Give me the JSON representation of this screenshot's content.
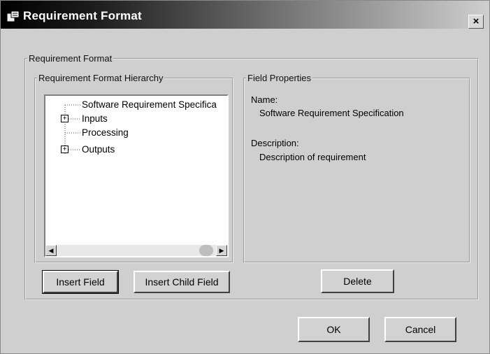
{
  "window": {
    "title": "Requirement Format",
    "close_label": "×"
  },
  "outer_group": {
    "label": "Requirement Format"
  },
  "hierarchy_group": {
    "label": "Requirement Format Hierarchy",
    "tree": [
      {
        "label": "Software Requirement Specifica",
        "expandable": false
      },
      {
        "label": "Inputs",
        "expandable": true,
        "expander": "+"
      },
      {
        "label": "Processing",
        "expandable": false
      },
      {
        "label": "Outputs",
        "expandable": true,
        "expander": "+"
      }
    ],
    "scroll_left": "◀",
    "scroll_right": "▶"
  },
  "properties_group": {
    "label": "Field Properties",
    "name_label": "Name:",
    "name_value": "Software Requirement Specification",
    "description_label": "Description:",
    "description_value": "Description of requirement"
  },
  "buttons": {
    "insert_field": "Insert Field",
    "insert_child_field": "Insert Child Field",
    "delete": "Delete",
    "ok": "OK",
    "cancel": "Cancel"
  }
}
